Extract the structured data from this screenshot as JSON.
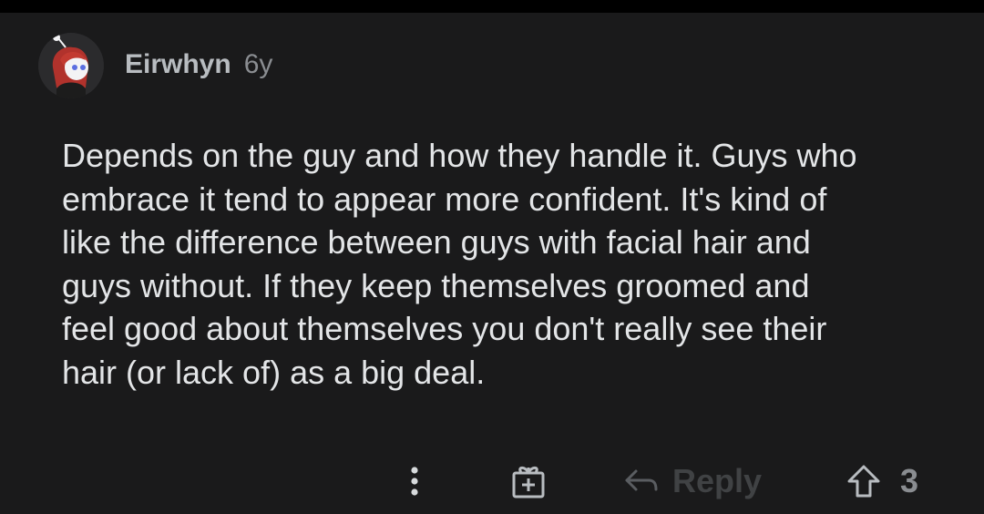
{
  "comment": {
    "author": "Eirwhyn",
    "age": "6y",
    "avatar_icon": "user-avatar-icon",
    "body": "Depends on the guy and how they handle it. Guys who\nembrace it tend to appear more confident. It's kind of\nlike the difference between guys with facial hair and\nguys without. If they keep themselves groomed and\nfeel good about themselves you don't really see their\nhair (or lack of) as a big deal."
  },
  "actions": {
    "more_icon": "more-vertical-icon",
    "award_icon": "gift-icon",
    "reply_icon": "reply-arrow-icon",
    "reply_label": "Reply",
    "upvote_icon": "upvote-arrow-icon",
    "vote_count": "3"
  },
  "colors": {
    "background": "#1a1a1b",
    "text": "#e3e5e7",
    "muted": "#8a8d91",
    "disabled": "#404244"
  }
}
